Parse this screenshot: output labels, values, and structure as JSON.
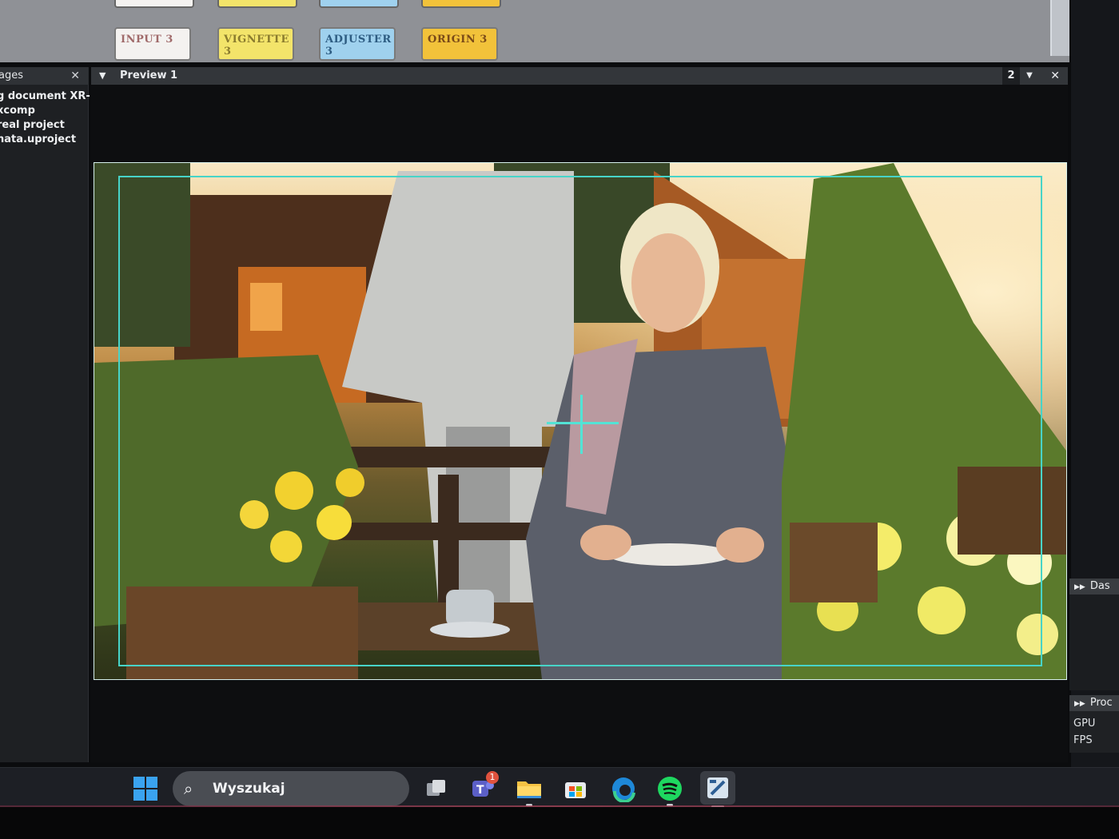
{
  "node_graph": {
    "nodes": [
      {
        "label": "INPUT 3"
      },
      {
        "label": "VIGNETTE 3"
      },
      {
        "label": "ADJUSTER 3"
      },
      {
        "label": "ORIGIN 3"
      }
    ]
  },
  "left_panel": {
    "header": "ages",
    "close": "✕",
    "items": [
      "g document XR-",
      "xcomp",
      "real project",
      "nata.uproject"
    ]
  },
  "preview": {
    "chevron": "▼",
    "title": "Preview 1",
    "view_number": "2",
    "dropdown": "▼",
    "close": "✕"
  },
  "right_panels": {
    "panel_a_title": "Das",
    "panel_b_title": "Proc",
    "panel_b_lines": [
      "GPU",
      "FPS"
    ]
  },
  "taskbar": {
    "search_label": "Wyszukaj",
    "teams_badge": "1"
  },
  "colors": {
    "safe_area": "#47d4c8",
    "node_input": "#f4f2f0",
    "node_vignette": "#f3e46a",
    "node_adjuster": "#9fd1ee",
    "node_origin": "#f2c23a"
  }
}
